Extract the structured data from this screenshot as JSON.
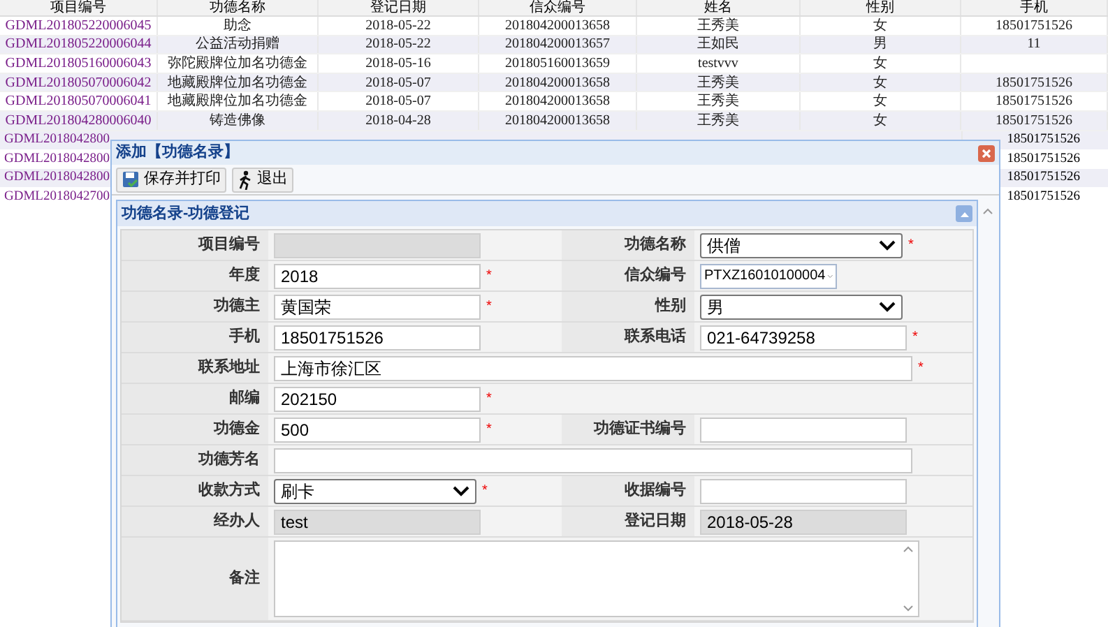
{
  "table": {
    "columns": [
      "项目编号",
      "功德名称",
      "登记日期",
      "信众编号",
      "姓名",
      "性别",
      "手机"
    ],
    "rows": [
      {
        "cells": [
          "GDML201805220006045",
          "助念",
          "2018-05-22",
          "201804200013658",
          "王秀美",
          "女",
          "18501751526"
        ]
      },
      {
        "cells": [
          "GDML201805220006044",
          "公益活动捐赠",
          "2018-05-22",
          "201804200013657",
          "王如民",
          "男",
          "11"
        ]
      },
      {
        "cells": [
          "GDML201805160006043",
          "弥陀殿牌位加名功德金",
          "2018-05-16",
          "201805160013659",
          "testvvv",
          "女"
        ]
      },
      {
        "cells": [
          "GDML201805070006042",
          "地藏殿牌位加名功德金",
          "2018-05-07",
          "201804200013658",
          "王秀美",
          "女",
          "18501751526"
        ]
      },
      {
        "cells": [
          "GDML201805070006041",
          "地藏殿牌位加名功德金",
          "2018-05-07",
          "201804200013658",
          "王秀美",
          "女",
          "18501751526"
        ]
      },
      {
        "cells": [
          "GDML201804280006040",
          "铸造佛像",
          "2018-04-28",
          "201804200013658",
          "王秀美",
          "女",
          "18501751526"
        ]
      }
    ],
    "covered_rows": [
      {
        "project_no": "GDML2018042800",
        "phone": "18501751526"
      },
      {
        "project_no": "GDML2018042800",
        "phone": "18501751526"
      },
      {
        "project_no": "GDML2018042800",
        "phone": "18501751526"
      },
      {
        "project_no": "GDML2018042700",
        "phone": "18501751526"
      }
    ]
  },
  "dialog": {
    "title": "添加【功德名录】",
    "toolbar": [
      {
        "kind": "save",
        "label": "保存并打印"
      },
      {
        "kind": "exit",
        "label": "退出"
      }
    ],
    "panel_title": "功德名录-功德登记",
    "rows": [
      {
        "fields": [
          {
            "label": "项目编号",
            "kind": "text",
            "disabled": true
          },
          {
            "label": "功德名称",
            "kind": "select",
            "value": "供僧",
            "required_mark": "*"
          }
        ]
      },
      {
        "fields": [
          {
            "label": "年度",
            "kind": "text",
            "value": "2018",
            "disabled": false,
            "required_mark": "*"
          },
          {
            "label": "信众编号",
            "kind": "combo",
            "value": "PTXZ16010100004"
          }
        ]
      },
      {
        "fields": [
          {
            "label": "功德主",
            "kind": "text",
            "value": "黄国荣",
            "disabled": false,
            "required_mark": "*"
          },
          {
            "label": "性别",
            "kind": "select",
            "value": "男"
          }
        ]
      },
      {
        "fields": [
          {
            "label": "手机",
            "kind": "text",
            "value": "18501751526",
            "disabled": false
          },
          {
            "label": "联系电话",
            "kind": "text",
            "value": "021-64739258",
            "disabled": false,
            "required_mark": "*"
          }
        ]
      },
      {
        "fields": [
          {
            "label": "联系地址",
            "kind": "wide",
            "value": "上海市徐汇区",
            "required_mark": "*"
          }
        ]
      },
      {
        "fields": [
          {
            "label": "邮编",
            "kind": "text",
            "value": "202150",
            "disabled": false,
            "required_mark": "*"
          }
        ]
      },
      {
        "fields": [
          {
            "label": "功德金",
            "kind": "text",
            "value": "500",
            "disabled": false,
            "required_mark": "*"
          },
          {
            "label": "功德证书编号",
            "kind": "text",
            "disabled": false
          }
        ]
      },
      {
        "fields": [
          {
            "label": "功德芳名",
            "kind": "wide"
          }
        ]
      },
      {
        "fields": [
          {
            "label": "收款方式",
            "kind": "select",
            "value": "刷卡",
            "required_mark": "*"
          },
          {
            "label": "收据编号",
            "kind": "text",
            "disabled": false
          }
        ]
      },
      {
        "fields": [
          {
            "label": "经办人",
            "kind": "text",
            "value": "test",
            "disabled": true
          },
          {
            "label": "登记日期",
            "kind": "text",
            "value": "2018-05-28",
            "disabled": true
          }
        ]
      },
      {
        "fields": [
          {
            "label": "备注",
            "kind": "textarea"
          }
        ]
      }
    ]
  }
}
